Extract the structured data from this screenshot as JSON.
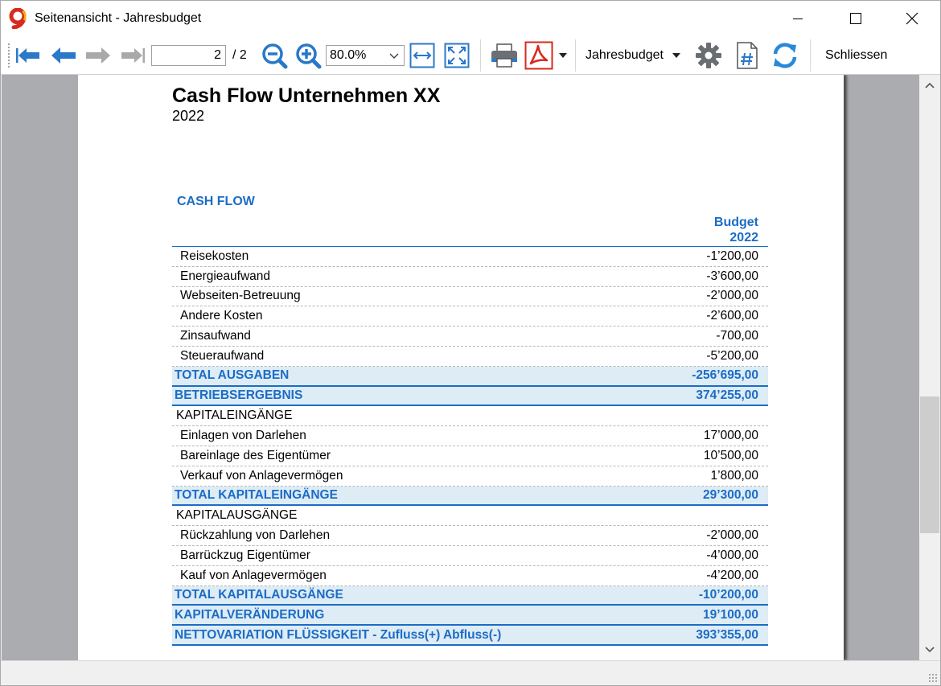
{
  "window": {
    "title": "Seitenansicht - Jahresbudget"
  },
  "toolbar": {
    "current_page": "2",
    "page_total": "/ 2",
    "zoom": "80.0%",
    "report_menu": "Jahresbudget",
    "close_label": "Schliessen",
    "icons": [
      "first-page-icon",
      "previous-page-icon",
      "next-page-icon",
      "last-page-icon",
      "zoom-out-icon",
      "zoom-in-icon",
      "fit-width-icon",
      "fit-page-icon",
      "print-icon",
      "pdf-icon",
      "gear-icon",
      "page-number-icon",
      "refresh-icon"
    ],
    "colors": {
      "nav_blue": "#2a78c8",
      "pdf_red": "#d52a1e",
      "refresh_blue": "#2a88d8"
    }
  },
  "report": {
    "title": "Cash Flow Unternehmen XX",
    "subtitle": "2022",
    "section": "CASH FLOW",
    "column_header_line1": "Budget",
    "column_header_line2": "2022",
    "accent_color": "#1b6cc7",
    "total_row_bg": "#ddecf5",
    "rows": [
      {
        "type": "item",
        "label": "Reisekosten",
        "value": "-1’200,00"
      },
      {
        "type": "item",
        "label": "Energieaufwand",
        "value": "-3’600,00"
      },
      {
        "type": "item",
        "label": "Webseiten-Betreuung",
        "value": "-2’000,00"
      },
      {
        "type": "item",
        "label": "Andere Kosten",
        "value": "-2’600,00"
      },
      {
        "type": "item",
        "label": "Zinsaufwand",
        "value": "-700,00"
      },
      {
        "type": "item",
        "label": "Steueraufwand",
        "value": "-5’200,00"
      },
      {
        "type": "total",
        "label": "TOTAL AUSGABEN",
        "value": "-256’695,00"
      },
      {
        "type": "total",
        "label": "BETRIEBSERGEBNIS",
        "value": "374’255,00"
      },
      {
        "type": "group",
        "label": "KAPITALEINGÄNGE",
        "value": ""
      },
      {
        "type": "item",
        "label": "Einlagen von Darlehen",
        "value": "17’000,00"
      },
      {
        "type": "item",
        "label": "Bareinlage des Eigentümer",
        "value": "10’500,00"
      },
      {
        "type": "item",
        "label": "Verkauf von Anlagevermögen",
        "value": "1’800,00"
      },
      {
        "type": "total",
        "label": "TOTAL KAPITALEINGÄNGE",
        "value": "29’300,00"
      },
      {
        "type": "group",
        "label": "KAPITALAUSGÄNGE",
        "value": ""
      },
      {
        "type": "item",
        "label": "Rückzahlung von Darlehen",
        "value": "-2’000,00"
      },
      {
        "type": "item",
        "label": "Barrückzug Eigentümer",
        "value": "-4’000,00"
      },
      {
        "type": "item",
        "label": "Kauf von Anlagevermögen",
        "value": "-4’200,00"
      },
      {
        "type": "total",
        "label": "TOTAL KAPITALAUSGÄNGE",
        "value": "-10’200,00"
      },
      {
        "type": "total",
        "label": "KAPITALVERÄNDERUNG",
        "value": "19’100,00"
      },
      {
        "type": "total",
        "label": "NETTOVARIATION FLÜSSIGKEIT -  Zufluss(+) Abfluss(-)",
        "value": "393’355,00"
      }
    ]
  }
}
